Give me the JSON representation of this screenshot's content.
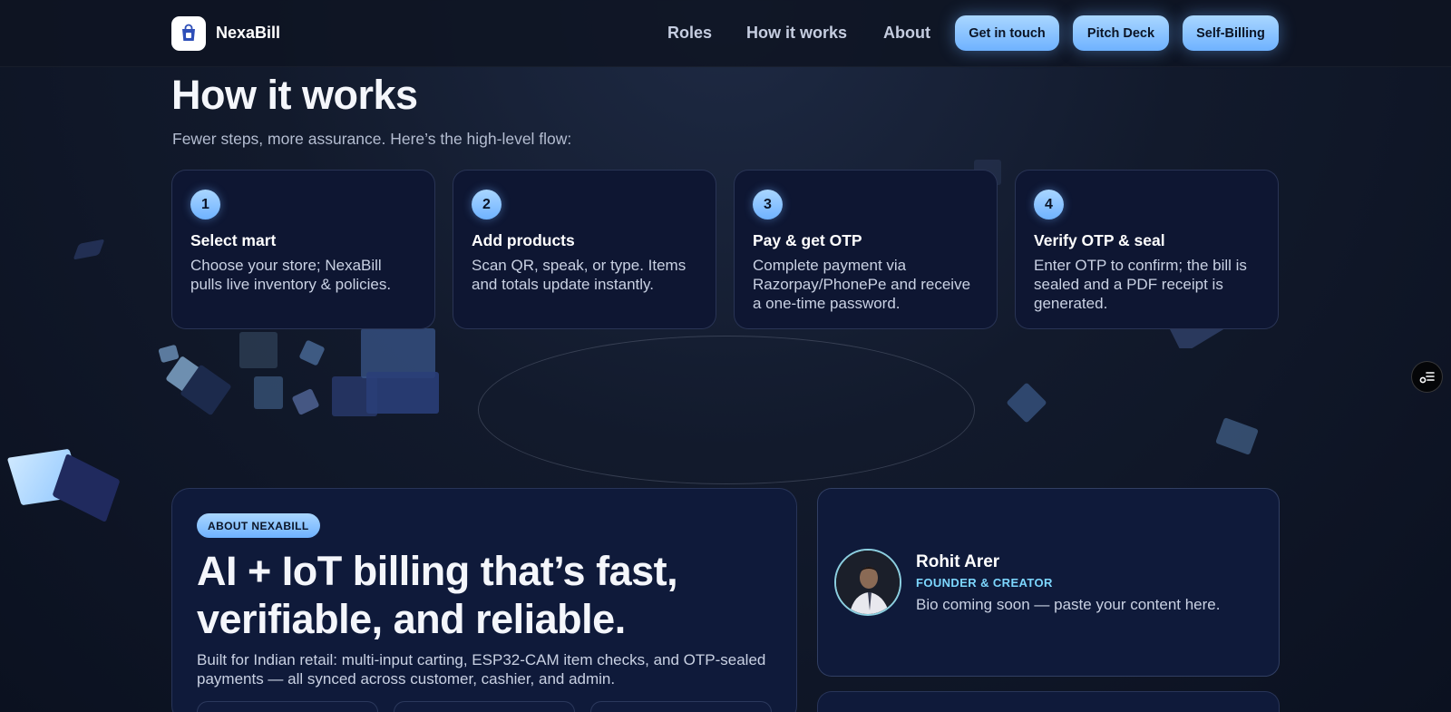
{
  "header": {
    "brand": "NexaBill",
    "nav": [
      "Roles",
      "How it works",
      "About"
    ],
    "buttons": [
      "Get in touch",
      "Pitch Deck",
      "Self-Billing"
    ]
  },
  "how_it_works": {
    "title": "How it works",
    "subtitle": "Fewer steps, more assurance. Here’s the high-level flow:",
    "steps": [
      {
        "num": "1",
        "title": "Select mart",
        "desc": "Choose your store; NexaBill pulls live inventory & policies."
      },
      {
        "num": "2",
        "title": "Add products",
        "desc": "Scan QR, speak, or type. Items and totals update instantly."
      },
      {
        "num": "3",
        "title": "Pay & get OTP",
        "desc": "Complete payment via Razorpay/PhonePe and receive a one-time password."
      },
      {
        "num": "4",
        "title": "Verify OTP & seal",
        "desc": "Enter OTP to confirm; the bill is sealed and a PDF receipt is generated."
      }
    ]
  },
  "about": {
    "badge": "ABOUT NEXABILL",
    "title": "AI + IoT billing that’s fast, verifiable, and reliable.",
    "desc": "Built for Indian retail: multi-input carting, ESP32-CAM item checks, and OTP-sealed payments — all synced across customer, cashier, and admin."
  },
  "founder": {
    "name": "Rohit Arer",
    "role": "FOUNDER & CREATOR",
    "bio": "Bio coming soon — paste your content here."
  },
  "colors": {
    "accent": "#8ec6ff",
    "card_bg": "#0e1632",
    "role_text": "#7dd7ff"
  },
  "icons": {
    "logo": "shopping-bag-icon",
    "side_button": "list-settings-icon"
  }
}
